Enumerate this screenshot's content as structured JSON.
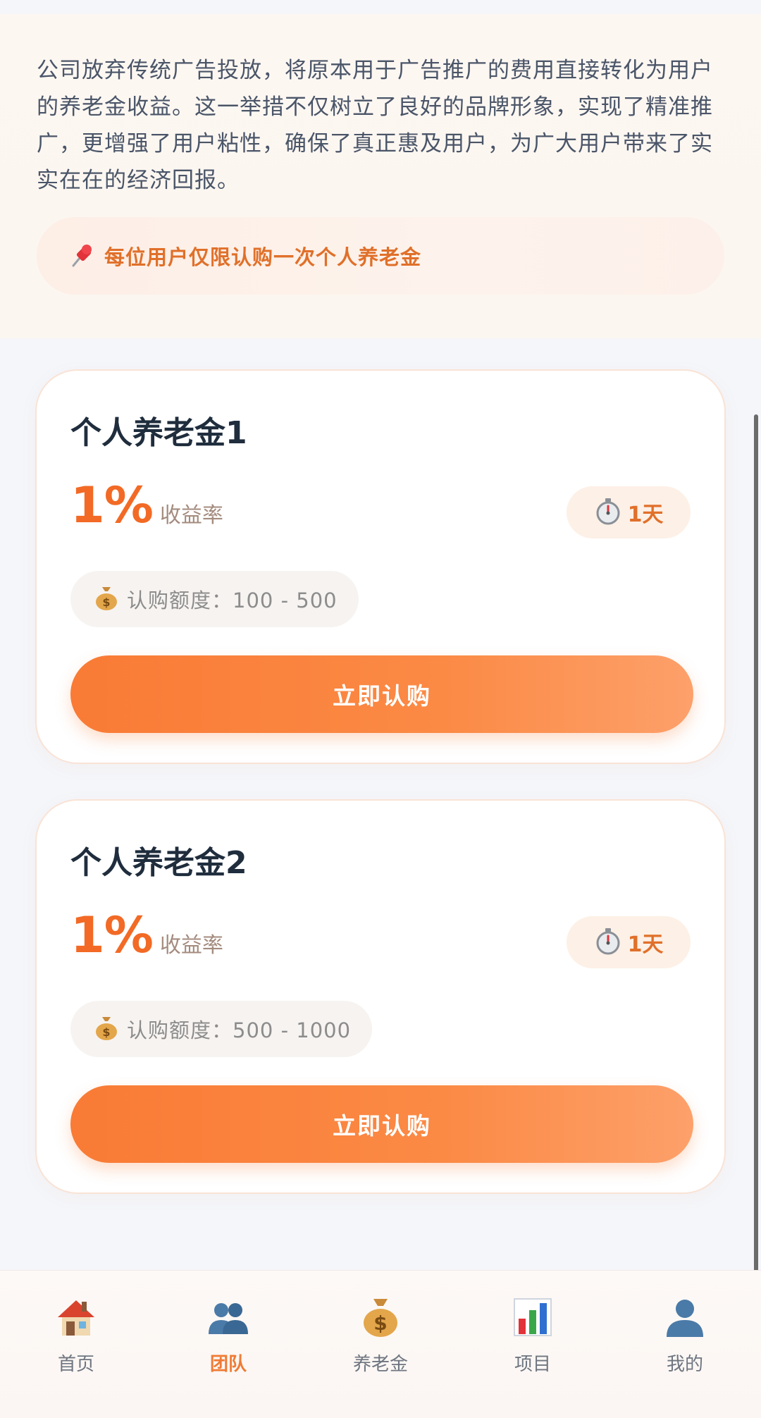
{
  "intro": {
    "text": "公司放弃传统广告投放，将原本用于广告推广的费用直接转化为用户的养老金收益。这一举措不仅树立了良好的品牌形象，实现了精准推广，更增强了用户粘性，确保了真正惠及用户，为广大用户带来了实实在在的经济回报。",
    "notice": "每位用户仅限认购一次个人养老金",
    "notice_icon": "pushpin-icon"
  },
  "products": [
    {
      "title": "个人养老金1",
      "rate": "1%",
      "rate_label": "收益率",
      "days": "1天",
      "amount": "认购额度：100 - 500",
      "button": "立即认购"
    },
    {
      "title": "个人养老金2",
      "rate": "1%",
      "rate_label": "收益率",
      "days": "1天",
      "amount": "认购额度：500 - 1000",
      "button": "立即认购"
    }
  ],
  "nav": {
    "items": [
      {
        "label": "首页",
        "icon": "house-icon"
      },
      {
        "label": "团队",
        "icon": "team-icon",
        "active": true
      },
      {
        "label": "养老金",
        "icon": "money-bag-icon"
      },
      {
        "label": "项目",
        "icon": "bar-chart-icon"
      },
      {
        "label": "我的",
        "icon": "user-icon"
      }
    ]
  },
  "colors": {
    "accent": "#f26a25",
    "button_start": "#f97b35",
    "button_end": "#fda06a",
    "active_nav": "#f07a33"
  }
}
